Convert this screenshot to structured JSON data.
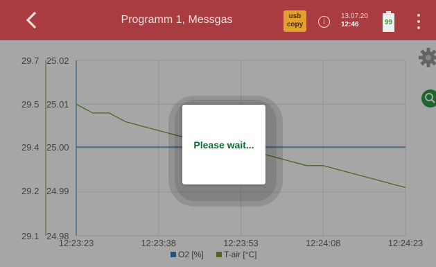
{
  "header": {
    "title": "Programm 1, Messgas",
    "usb_line1": "usb",
    "usb_line2": "copy",
    "info_symbol": "i",
    "date": "13.07.20",
    "time": "12:46",
    "battery_percent": "99",
    "icons": {
      "back": "chevron-left-icon",
      "menu": "more-vert-icon",
      "battery": "battery-icon"
    }
  },
  "side_tools": {
    "settings": "gear-icon",
    "zoom": "zoom-icon"
  },
  "dialog": {
    "message": "Please wait..."
  },
  "colors": {
    "header": "#a83c40",
    "o2": "#3b7fc4",
    "tair": "#7a9a3a",
    "usb": "#e2a12c",
    "dialog_text": "#0b6d2a"
  },
  "chart_data": {
    "type": "line",
    "x": [
      "12:23:23",
      "12:23:26",
      "12:23:29",
      "12:23:32",
      "12:23:35",
      "12:23:38",
      "12:23:41",
      "12:23:44",
      "12:23:47",
      "12:23:50",
      "12:23:53",
      "12:23:56",
      "12:23:59",
      "12:24:02",
      "12:24:05",
      "12:24:08",
      "12:24:11",
      "12:24:14",
      "12:24:17",
      "12:24:20",
      "12:24:23"
    ],
    "x_ticks": [
      "12:23:23",
      "12:23:38",
      "12:23:53",
      "12:24:08",
      "12:24:23"
    ],
    "y1_ticks": [
      "29.7",
      "29.5",
      "29.4",
      "29.2",
      "29.1"
    ],
    "y2_ticks": [
      "25.02",
      "25.01",
      "25.00",
      "24.99",
      "24.98"
    ],
    "y1_range": [
      29.1,
      29.7
    ],
    "y2_range": [
      24.98,
      25.02
    ],
    "series": [
      {
        "name": "O2 [%]",
        "axis": "y1",
        "values": [
          29.4,
          29.4,
          29.4,
          29.4,
          29.4,
          29.4,
          29.4,
          29.4,
          29.4,
          29.4,
          29.4,
          29.4,
          29.4,
          29.4,
          29.4,
          29.4,
          29.4,
          29.4,
          29.4,
          29.4,
          29.4
        ]
      },
      {
        "name": "T-air [°C]",
        "axis": "y2",
        "values": [
          25.01,
          25.008,
          25.008,
          25.006,
          25.005,
          25.004,
          25.003,
          25.002,
          25.001,
          25.0,
          25.0,
          24.999,
          24.998,
          24.997,
          24.996,
          24.996,
          24.995,
          24.994,
          24.993,
          24.992,
          24.991
        ]
      }
    ],
    "grid": true,
    "legend": "bottom-center"
  }
}
